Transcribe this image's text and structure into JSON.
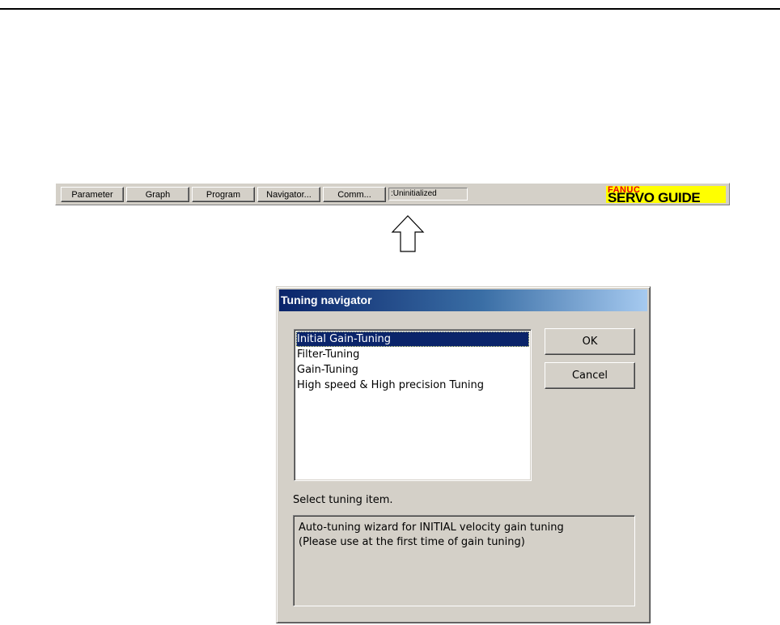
{
  "toolbar": {
    "buttons": [
      "Parameter",
      "Graph",
      "Program",
      "Navigator...",
      "Comm..."
    ],
    "status": ":Uninitialized",
    "logo": {
      "top": "FANUC",
      "main": "SERVO GUIDE",
      "colors": {
        "bg": "#ffff00",
        "top": "#e8000b",
        "main": "#000000"
      }
    }
  },
  "arrow": {
    "icon": "up-arrow-icon"
  },
  "dialog": {
    "title": "Tuning navigator",
    "items": [
      "Initial Gain-Tuning",
      "Filter-Tuning",
      "Gain-Tuning",
      "High speed & High precision Tuning"
    ],
    "selected_index": 0,
    "ok_label": "OK",
    "cancel_label": "Cancel",
    "prompt": "Select tuning item.",
    "description": [
      "Auto-tuning wizard for INITIAL velocity gain tuning",
      "(Please use at the first time of gain tuning)"
    ]
  },
  "colors": {
    "face": "#d4d0c8",
    "title_start": "#0a246a",
    "title_end": "#a6caf0",
    "selection": "#0a246a"
  }
}
